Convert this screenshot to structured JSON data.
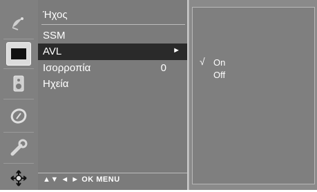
{
  "icons": [
    {
      "name": "channel-icon",
      "active": false
    },
    {
      "name": "picture-icon",
      "active": true
    },
    {
      "name": "audio-icon",
      "active": false
    },
    {
      "name": "time-icon",
      "active": false
    },
    {
      "name": "setup-icon",
      "active": false
    },
    {
      "name": "source-icon",
      "active": false
    }
  ],
  "menu": {
    "title": "Ήχος",
    "items": [
      {
        "label": "SSM",
        "value": "",
        "arrow": ""
      },
      {
        "label": "AVL",
        "value": "",
        "arrow": "►"
      },
      {
        "label": "Ισορροπία",
        "value": "0",
        "arrow": ""
      },
      {
        "label": "Ηχεία",
        "value": "",
        "arrow": ""
      }
    ],
    "footer": "▲▼  ◄ ►  OK  MENU"
  },
  "submenu": {
    "check": "√",
    "options": [
      "On",
      "Off"
    ]
  }
}
